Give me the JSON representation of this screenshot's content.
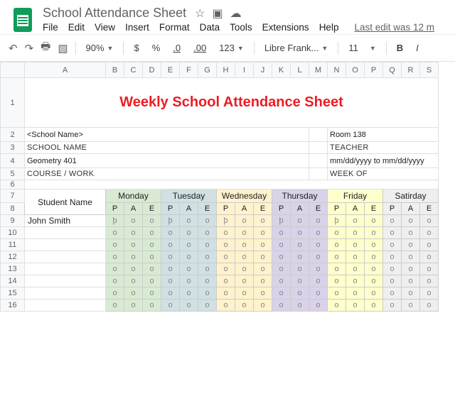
{
  "doc": {
    "title": "School Attendance Sheet"
  },
  "menu": {
    "file": "File",
    "edit": "Edit",
    "view": "View",
    "insert": "Insert",
    "format": "Format",
    "data": "Data",
    "tools": "Tools",
    "extensions": "Extensions",
    "help": "Help",
    "last_edit": "Last edit was 12 m"
  },
  "toolbar": {
    "zoom": "90%",
    "dollar": "$",
    "percent": "%",
    "dec_dec": ".0",
    "inc_dec": ".00",
    "numfmt": "123",
    "font": "Libre Frank...",
    "size": "11",
    "bold": "B",
    "italic": "I"
  },
  "cols": [
    "",
    "A",
    "B",
    "C",
    "D",
    "E",
    "F",
    "G",
    "H",
    "I",
    "J",
    "K",
    "L",
    "M",
    "N",
    "O",
    "P",
    "Q",
    "R",
    "S"
  ],
  "sheet": {
    "title": "Weekly School Attendance Sheet",
    "school_name_val": "<School Name>",
    "school_name_lbl": "SCHOOL NAME",
    "room_val": "Room 138",
    "room_lbl": "TEACHER",
    "course_val": "Geometry 401",
    "course_lbl": "COURSE / WORK",
    "week_val": "mm/dd/yyyy to mm/dd/yyyy",
    "week_lbl": "WEEK OF",
    "student_name_head": "Student Name",
    "days": [
      "Monday",
      "Tuesday",
      "Wednesday",
      "Thursday",
      "Friday",
      "Satirday"
    ],
    "pae": [
      "P",
      "A",
      "E"
    ],
    "students": [
      "John Smith",
      "",
      "",
      "",
      "",
      "",
      "",
      ""
    ],
    "first_row": [
      "þ",
      "o",
      "o",
      "þ",
      "o",
      "o",
      "þ",
      "o",
      "o",
      "þ",
      "o",
      "o",
      "þ",
      "o",
      "o",
      "o",
      "o",
      "o"
    ],
    "o": "o"
  }
}
